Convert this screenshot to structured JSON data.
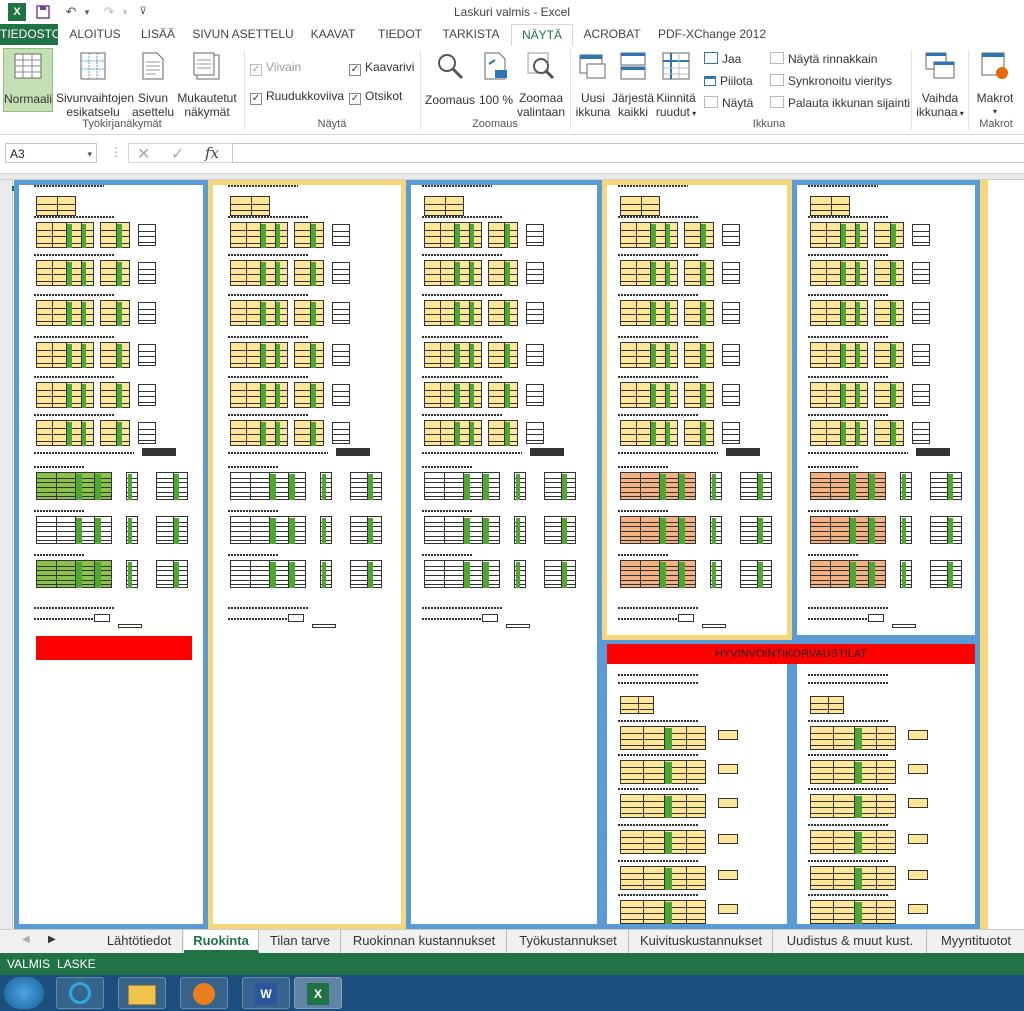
{
  "window": {
    "title": "Laskuri valmis - Excel"
  },
  "quick_access": {
    "icons": [
      "excel-logo-icon",
      "save-icon",
      "undo-icon",
      "redo-icon",
      "customize-icon"
    ]
  },
  "ribbon_tabs": [
    "TIEDOSTO",
    "ALOITUS",
    "LISÄÄ",
    "SIVUN ASETTELU",
    "KAAVAT",
    "TIEDOT",
    "TARKISTA",
    "NÄYTÄ",
    "ACROBAT",
    "PDF-XChange 2012"
  ],
  "active_ribbon_tab": "NÄYTÄ",
  "ribbon": {
    "workbook_views": {
      "group_label": "Työkirjanäkymät",
      "normal": "Normaali",
      "page_break_1": "Sivunvaihtojen",
      "page_break_2": "esikatselu",
      "page_layout_1": "Sivun",
      "page_layout_2": "asettelu",
      "custom_1": "Mukautetut",
      "custom_2": "näkymät"
    },
    "show": {
      "group_label": "Näytä",
      "ruler": "Viivain",
      "formula_bar": "Kaavarivi",
      "gridlines": "Ruudukkoviiva",
      "headings": "Otsikot"
    },
    "zoom": {
      "group_label": "Zoomaus",
      "zoom": "Zoomaus",
      "hundred": "100 %",
      "zoom_selection_1": "Zoomaa",
      "zoom_selection_2": "valintaan"
    },
    "window": {
      "group_label": "Ikkuna",
      "new_window_1": "Uusi",
      "new_window_2": "ikkuna",
      "arrange_1": "Järjestä",
      "arrange_2": "kaikki",
      "freeze_1": "Kiinnitä",
      "freeze_2": "ruudut",
      "split": "Jaa",
      "hide": "Piilota",
      "unhide": "Näytä",
      "side_by_side": "Näytä rinnakkain",
      "sync_scroll": "Synkronoitu vieritys",
      "reset_position": "Palauta ikkunan sijainti",
      "switch_1": "Vaihda",
      "switch_2": "ikkunaa"
    },
    "macros": {
      "group_label": "Makrot",
      "macros": "Makrot"
    }
  },
  "formula_bar": {
    "name_box": "A3",
    "cancel_symbol": "✕",
    "enter_symbol": "✓",
    "fx": "fx",
    "content": ""
  },
  "sheet": {
    "banner": "HYVINVOINTIKORVAUSTILAT",
    "colors": {
      "blue_border": "#5b9bd5",
      "yellow_border": "#f5d67a",
      "cell_yellow": "#ffe699",
      "green": "#4ea72e",
      "red": "#ff0000",
      "salmon": "#f4b183"
    }
  },
  "sheet_tabs": [
    "Lähtötiedot",
    "Ruokinta",
    "Tilan tarve",
    "Ruokinnan kustannukset",
    "Työkustannukset",
    "Kuivituskustannukset",
    "Uudistus & muut kust.",
    "Myyntituotot"
  ],
  "active_sheet_tab": "Ruokinta",
  "status_bar": {
    "left": "VALMIS",
    "right": "LASKE"
  },
  "taskbar": {
    "apps": [
      "start-orb-icon",
      "internet-explorer-icon",
      "file-explorer-icon",
      "media-player-icon",
      "word-icon",
      "excel-icon"
    ]
  }
}
